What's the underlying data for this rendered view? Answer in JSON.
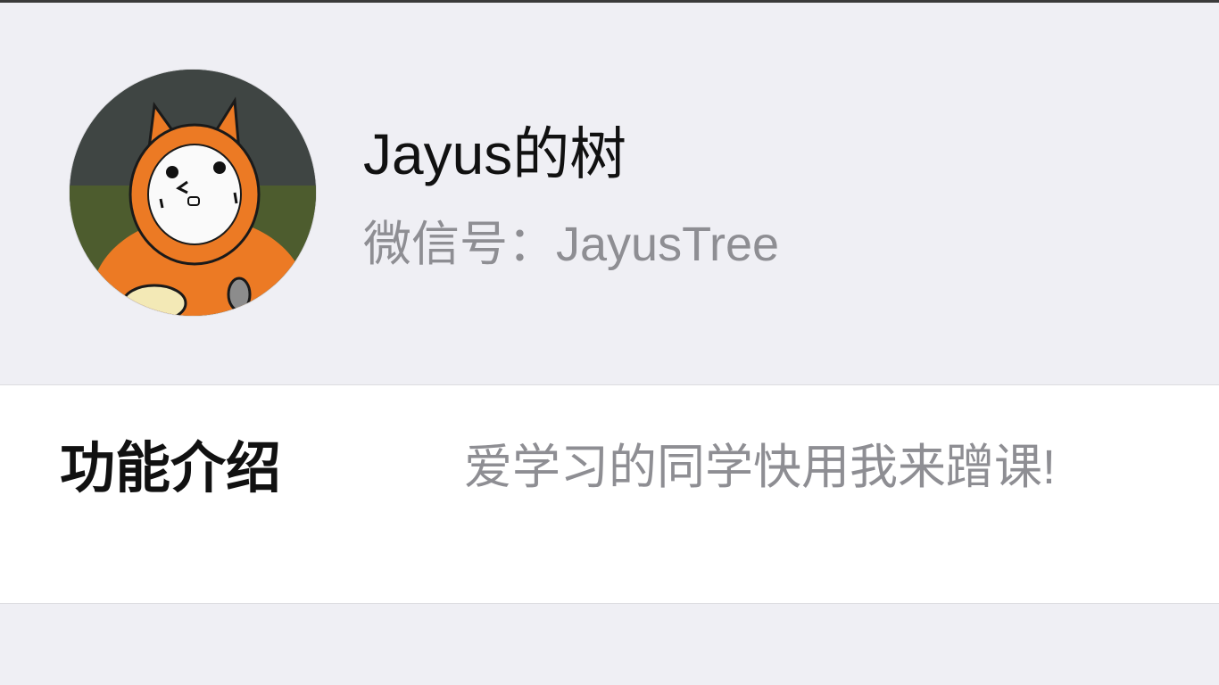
{
  "profile": {
    "avatar_icon": "cartoon-alpaca-avatar",
    "name": "Jayus的树",
    "wechat_id_label": "微信号：",
    "wechat_id_value": "JayusTree"
  },
  "intro": {
    "label": "功能介绍",
    "text": "爱学习的同学快用我来蹭课!"
  },
  "colors": {
    "page_background": "#efeff4",
    "card_background": "#ffffff",
    "primary_text": "#111111",
    "secondary_text": "#8e8e93"
  }
}
